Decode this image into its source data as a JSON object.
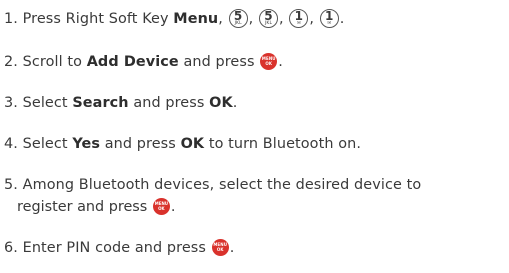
{
  "steps": [
    {
      "num": "1.",
      "pre": "Press Right Soft Key",
      "bold": "Menu",
      "after_bold": ",",
      "keys": [
        {
          "num": "5",
          "sub": "JKL"
        },
        {
          "num": "5",
          "sub": "JKL"
        },
        {
          "num": "1",
          "sub": "✉"
        },
        {
          "num": "1",
          "sub": "✉"
        }
      ],
      "sep": ",",
      "end": "."
    },
    {
      "num": "2.",
      "pre": "Scroll to",
      "bold": "Add Device",
      "post": "and press",
      "end": "."
    },
    {
      "num": "3.",
      "pre": "Select",
      "bold": "Search",
      "post": "and press",
      "bold2": "OK",
      "end": "."
    },
    {
      "num": "4.",
      "pre": "Select",
      "bold": "Yes",
      "post": "and press",
      "bold2": "OK",
      "post2": "to turn Bluetooth on."
    },
    {
      "num": "5.",
      "line1": "Among Bluetooth devices, select the desired device to",
      "line2": "register and press",
      "end": "."
    },
    {
      "num": "6.",
      "pre": "Enter PIN code and press",
      "end": "."
    }
  ],
  "menu_ok_icon": {
    "line1": "MENU",
    "line2": "OK",
    "color": "#d9322c",
    "name": "menu-ok-key-icon"
  },
  "keypad_icon_name": "keypad-key-icon"
}
